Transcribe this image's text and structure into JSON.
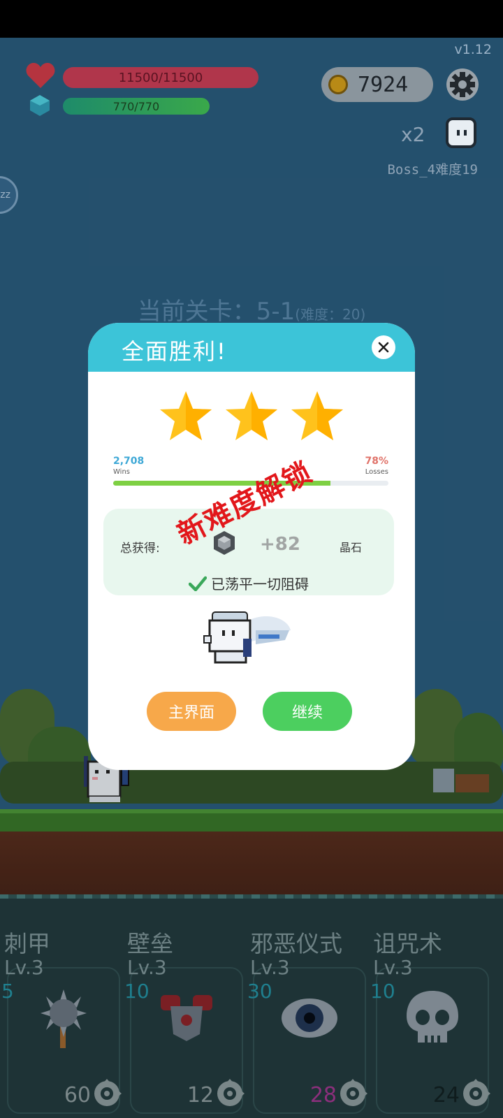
{
  "app": {
    "version": "v1.12"
  },
  "hud": {
    "hp": "11500/11500",
    "mp": "770/770",
    "coins": "7924",
    "multiplier": "x2",
    "boss_label": "Boss_4难度19",
    "zz_button": "zz"
  },
  "stage": {
    "title": "当前关卡：5-1",
    "difficulty": "(难度：20)"
  },
  "modal": {
    "title": "全面胜利!",
    "stars": 3,
    "wins_value": "2,708",
    "wins_label": "Wins",
    "losses_value": "78%",
    "losses_label": "Losses",
    "progress_fraction": 0.79,
    "stamp": "新难度解锁",
    "reward_label": "总获得:",
    "reward_amount": "+82",
    "reward_unit": "晶石",
    "cleared_text": "已荡平一切阻碍",
    "home_button": "主界面",
    "continue_button": "继续"
  },
  "skills": [
    {
      "name": "刺甲",
      "level": "Lv.3",
      "cost": "5",
      "count": "60",
      "icon": "spiked-mace-icon"
    },
    {
      "name": "壁垒",
      "level": "Lv.3",
      "cost": "10",
      "count": "12",
      "icon": "armor-icon"
    },
    {
      "name": "邪恶仪式",
      "level": "Lv.3",
      "cost": "30",
      "count": "28",
      "icon": "eye-icon"
    },
    {
      "name": "诅咒术",
      "level": "Lv.3",
      "cost": "10",
      "count": "24",
      "icon": "skull-icon"
    }
  ],
  "colors": {
    "header": "#3cc4d8",
    "star": "#ffc21c",
    "home_button": "#f7a84a",
    "continue_button": "#4ccf5f",
    "stamp": "#e2171b"
  }
}
